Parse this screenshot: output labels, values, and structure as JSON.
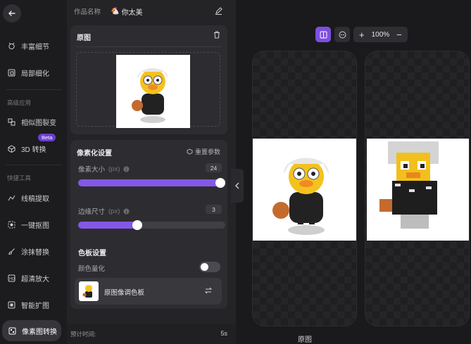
{
  "nav": {
    "items": [
      {
        "label": "丰富细节",
        "icon": "detail-icon"
      },
      {
        "label": "局部细化",
        "icon": "refine-icon"
      },
      {
        "label": "相似图裂变",
        "icon": "similar-icon"
      },
      {
        "label": "3D 转换",
        "icon": "cube-icon"
      },
      {
        "label": "线稿提取",
        "icon": "line-icon"
      },
      {
        "label": "一键抠图",
        "icon": "cutout-icon"
      },
      {
        "label": "涂抹替换",
        "icon": "brush-icon"
      },
      {
        "label": "超清放大",
        "icon": "upscale-icon"
      },
      {
        "label": "智能扩图",
        "icon": "expand-icon"
      },
      {
        "label": "像素图转换",
        "icon": "pixel-icon"
      }
    ],
    "section_advanced": "高级应用",
    "section_quick": "快捷工具",
    "beta_badge": "Beta"
  },
  "work_name": {
    "label": "作品名称",
    "value": "你太美"
  },
  "original_card": {
    "title": "原图"
  },
  "pixel_settings": {
    "title": "像素化设置",
    "reset_label": "重置参数",
    "pixel_size": {
      "label": "像素大小",
      "unit": "(px)",
      "value": "24",
      "fraction": 0.98
    },
    "edge_size": {
      "label": "边缘尺寸",
      "unit": "(px)",
      "value": "3",
      "fraction": 0.4
    },
    "palette_title": "色板设置",
    "quantize_label": "颜色量化",
    "quantize_on": false,
    "palette_name": "原图像调色板"
  },
  "footer": {
    "time_label": "预计时间:",
    "time_value": "5s"
  },
  "canvas": {
    "zoom": "100%",
    "bottom_label": "原图"
  },
  "colors": {
    "accent": "#7d4fe0",
    "panel": "#242427",
    "background": "#1c1c1e"
  }
}
